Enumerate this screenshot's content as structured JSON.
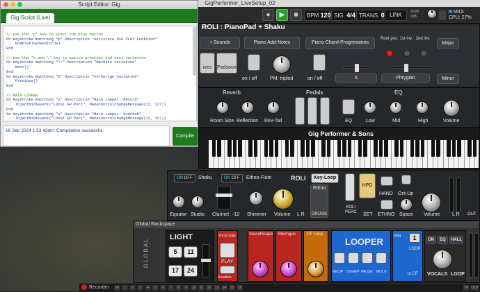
{
  "window_title": "GigPerformer_LiveSetup_02",
  "toolbar": {
    "bpm_label": "BPM",
    "bpm_value": "120.0",
    "sig_label": "SIG.",
    "sig_value": "4/4",
    "trans_label": "TRANS.",
    "trans_value": "0",
    "link_label": "LINK",
    "trim_label": "TRIM",
    "trim_value": "0dB",
    "midi_label": "MIDI",
    "cpu_label": "CPU:",
    "cpu_value": "27%"
  },
  "script_editor": {
    "title": "Script Editor:  Gig",
    "tab_label": "Gig Script (Live)",
    "code_lines": [
      {
        "t": "",
        "c": false
      },
      {
        "t": "// Use the 'p' key to start the play button",
        "c": true
      },
      {
        "t": "On Keystroke matching \"p\" Description \"Aktiviere die PLAY Funktion\"",
        "c": false
      },
      {
        "t": "    EnablePlayhead(true)",
        "c": false
      },
      {
        "t": "End",
        "c": false
      },
      {
        "t": "",
        "c": false
      },
      {
        "t": "// Use the 'k and \\' key to switch previous and next variation",
        "c": true
      },
      {
        "t": "On Keystroke matching \"\\\\\" Description \"Nächste Variation\"",
        "c": false
      },
      {
        "t": "    Next()",
        "c": false
      },
      {
        "t": "End",
        "c": false
      },
      {
        "t": "On Keystroke matching \"k\" Description \"Vorherige Variation\"",
        "c": false
      },
      {
        "t": "    Previous()",
        "c": false
      },
      {
        "t": "End",
        "c": false
      },
      {
        "t": "",
        "c": false
      },
      {
        "t": "// MAIN LOOPER",
        "c": true
      },
      {
        "t": "On Keystroke matching \"y\" Description \"Main Looper: Record\"",
        "c": false
      },
      {
        "t": "    InjectMidiEvent(\"Local GP Port\", MakeControlChangeMessage(11, 127))",
        "c": false
      },
      {
        "t": "End",
        "c": false
      },
      {
        "t": "On Keystroke matching \"x\" Description \"Main Looper: Overdub\"",
        "c": false
      },
      {
        "t": "    InjectMidiEvent(\"Local GP Port\", MakeControlChangeMessage(12, 127))",
        "c": false
      },
      {
        "t": "End",
        "c": false
      },
      {
        "t": "On Keystroke matching \"c\" Description \"Main Looper: Play\"",
        "c": false
      }
    ],
    "status": "18 Sep 2024 1:53:42pm: Compilation successful.",
    "compile_label": "Compile"
  },
  "rackspace": {
    "title": "ROLI : PianoPad + Shaku",
    "sounds_label": "+ Sounds",
    "add_notes_label": "Piano Add-Notes",
    "chord_prog_label": "Piano Chord-Progressions",
    "root_pos_label": "Root pos.",
    "inv1_label": "1st inv.",
    "inv2_label": "2nd inv.",
    "major_label": "Major",
    "minor_label": "Minor",
    "lives_label": "ives",
    "padsound_label": "Padsound",
    "on_off_1": "on / off",
    "pm_tripled": "PM: tripled",
    "on_off_2": "on / off",
    "key_a": "A",
    "scale_phrygian": "Phrygian",
    "reverb_label": "Reverb",
    "pedals_label": "Pedals",
    "eq_label": "EQ",
    "room_size": "Room Size",
    "reflection": "Reflection",
    "rev_tail": "Rev-Tail",
    "eq_btn": "EQ",
    "low": "Low",
    "mid": "Mid",
    "high": "High",
    "volume": "Volume",
    "gps_label": "Gig Performer & Sons",
    "shaku_on": "ON",
    "shaku_off": "OFF",
    "shaku_label": "Shaku",
    "ethno_on": "ON",
    "ethno_off": "OFF",
    "ethno_label": "Ethno-Flute",
    "roli_label": "ROLI",
    "keyloop_label": "Key-Loop",
    "equator": "Equator",
    "studio": "Studio",
    "clarinet": "Clarinet",
    "clarinet_val": "-12",
    "shimmer": "Shimmer",
    "volume2": "Volume",
    "lr": "L  R",
    "ethno_btn": "Ethno",
    "drums_btn": "DRUMS",
    "roli_perc": "ROLI PERC",
    "hpd": "HPD",
    "set_label": "SET",
    "hand": "HAND",
    "ethno2": "ETHNO",
    "oct_up": "Oct-Up",
    "space": "Space",
    "volume3": "Volume",
    "lr2": "L   R",
    "out": "OUT",
    "off_small": "OFF"
  },
  "global_rack": {
    "label": "Global Rackspace",
    "side_label": "GLOBAL",
    "light": "LIGHT",
    "light_nums": [
      "5",
      "11",
      "17",
      "24"
    ],
    "system": "SYSTEM",
    "play": "PLAY",
    "sonobus": "Sonobus",
    "soundscape": "SoundScape",
    "meringue": "Meringue",
    "cf_loop": "CF Loop",
    "looper": "LOOPER",
    "rec_p": "REC/P",
    "overp": "OVER/P",
    "pause": "PAUSE",
    "multi": "MULTI",
    "ryn": "R/N",
    "loop_num": "1",
    "loop_label": "LOOP",
    "to_cf": "to CF",
    "on": "ON",
    "eq": "EQ",
    "hall": "HALL",
    "vocals": "VOCALS",
    "loop2": "LOOP",
    "in": "IN"
  },
  "recorder": {
    "label": "Recorder",
    "inputs": [
      "IN",
      "1",
      "2",
      "3",
      "4",
      "5",
      "6",
      "7",
      "8",
      "9",
      "10",
      "11",
      "12",
      "13",
      "14",
      "15",
      "16"
    ],
    "right_inputs": [
      "IN",
      "OUT"
    ]
  },
  "colors": {
    "accent_green": "#1f7a1f",
    "led_red": "#e02020",
    "looper_blue": "#1e66d0"
  }
}
